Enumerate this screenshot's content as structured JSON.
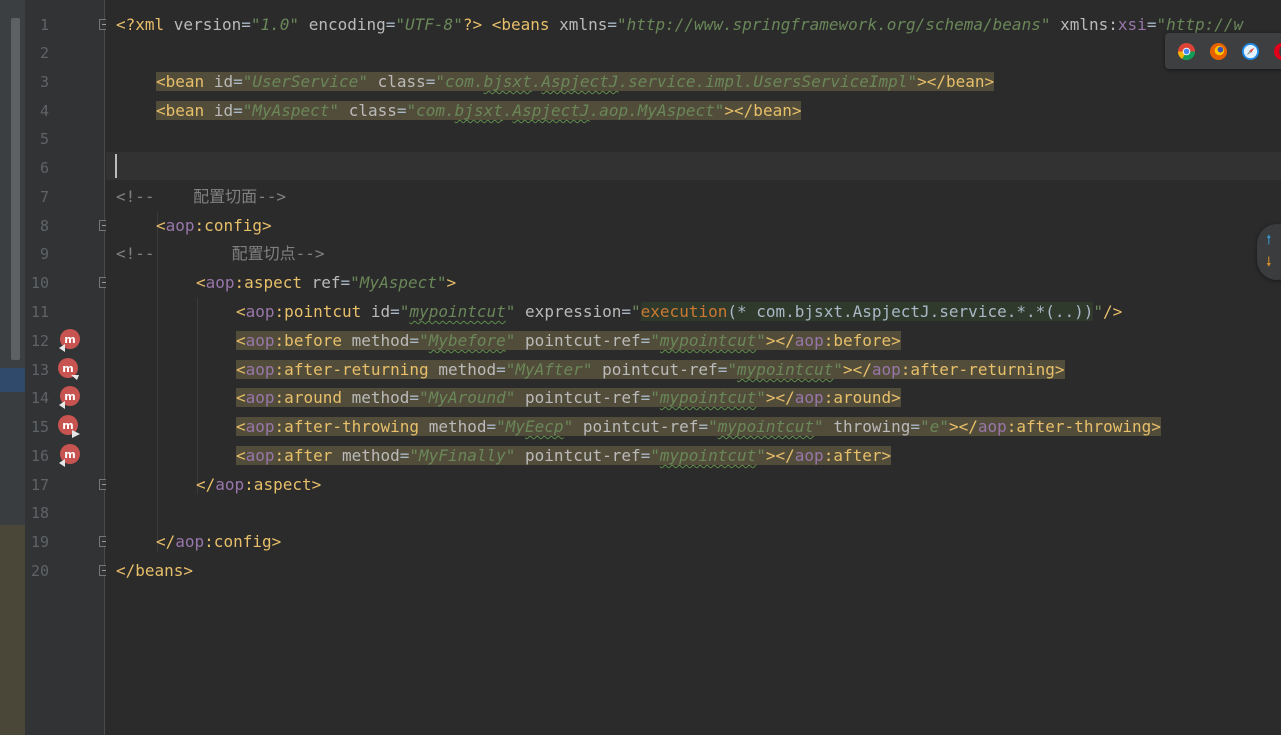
{
  "editor": {
    "line_numbers": [
      "1",
      "2",
      "3",
      "4",
      "5",
      "6",
      "7",
      "8",
      "9",
      "10",
      "11",
      "12",
      "13",
      "14",
      "15",
      "16",
      "17",
      "18",
      "19",
      "20"
    ],
    "lines": {
      "l1": {
        "open_pi": "<?xml ",
        "version_attr": "version",
        "eq1": "=",
        "version_val": "\"1.0\"",
        "sp1": " ",
        "encoding_attr": "encoding",
        "eq2": "=",
        "encoding_val": "\"UTF-8\"",
        "close_pi": "?>",
        "sp2": " ",
        "open_tag": "<beans",
        "sp3": " ",
        "xmlns_attr": "xmlns",
        "eq3": "=",
        "xmlns_val": "\"http://www.springframework.org/schema/beans\"",
        "sp4": " ",
        "xmlns_prefix": "xmlns:",
        "xsi_ns": "xsi",
        "eq4": "=",
        "xsi_val": "\"http://w"
      },
      "l3": {
        "open": "<bean",
        "sp1": " ",
        "id_attr": "id",
        "eq1": "=",
        "id_val": "\"UserService\"",
        "sp2": " ",
        "class_attr": "class",
        "eq2": "=",
        "class_val_1": "\"com.",
        "class_val_2": "bjsxt",
        "class_val_3": ".",
        "class_val_4": "AspjectJ",
        "class_val_5": ".service.impl.UsersServiceImpl\"",
        "close": "></bean>"
      },
      "l4": {
        "open": "<bean",
        "sp1": " ",
        "id_attr": "id",
        "eq1": "=",
        "id_val": "\"MyAspect\"",
        "sp2": " ",
        "class_attr": "class",
        "eq2": "=",
        "class_val_1": "\"com.",
        "class_val_2": "bjsxt",
        "class_val_3": ".",
        "class_val_4": "AspjectJ",
        "class_val_5": ".aop.MyAspect\"",
        "close": "></bean>"
      },
      "l7": {
        "comment": "<!--    配置切面-->"
      },
      "l8": {
        "open": "<",
        "ns": "aop",
        "rest": ":config",
        "close": ">"
      },
      "l9": {
        "comment": "<!--        配置切点-->"
      },
      "l10": {
        "open": "<",
        "ns": "aop",
        "rest": ":aspect",
        "sp": " ",
        "attr": "ref",
        "eq": "=",
        "val": "\"MyAspect\"",
        "close": ">"
      },
      "l11": {
        "open": "<",
        "ns": "aop",
        "rest": ":pointcut",
        "sp1": " ",
        "id_attr": "id",
        "eq1": "=",
        "q1": "\"",
        "id_val": "mypointcut",
        "q2": "\"",
        "sp2": " ",
        "expr_attr": "expression",
        "eq2": "=",
        "q3": "\"",
        "fn": "execution",
        "expr_body": "(* com.bjsxt.AspjectJ.service.*.*(..))",
        "q4": "\"",
        "close": "/>"
      },
      "l12": {
        "open": "<",
        "ns": "aop",
        "rest": ":before",
        "sp1": " ",
        "method_attr": "method",
        "eq1": "=",
        "q1": "\"",
        "method_val": "Mybefore",
        "q2": "\"",
        "sp2": " ",
        "ref_attr": "pointcut-ref",
        "eq2": "=",
        "q3": "\"",
        "ref_val": "mypointcut",
        "q4": "\"",
        "mid": "></",
        "end_ns": "aop",
        "end_rest": ":before",
        "close": ">"
      },
      "l13": {
        "open": "<",
        "ns": "aop",
        "rest": ":after-returning",
        "sp1": " ",
        "method_attr": "method",
        "eq1": "=",
        "method_val_full": "\"MyAfter\"",
        "sp2": " ",
        "ref_attr": "pointcut-ref",
        "eq2": "=",
        "q3": "\"",
        "ref_val": "mypointcut",
        "q4": "\"",
        "mid": "></",
        "end_ns": "aop",
        "end_rest": ":after-returning",
        "close": ">"
      },
      "l14": {
        "open": "<",
        "ns": "aop",
        "rest": ":around",
        "sp1": " ",
        "method_attr": "method",
        "eq1": "=",
        "method_val_full": "\"MyAround\"",
        "sp2": " ",
        "ref_attr": "pointcut-ref",
        "eq2": "=",
        "q3": "\"",
        "ref_val": "mypointcut",
        "q4": "\"",
        "mid": "></",
        "end_ns": "aop",
        "end_rest": ":around",
        "close": ">"
      },
      "l15": {
        "open": "<",
        "ns": "aop",
        "rest": ":after-throwing",
        "sp1": " ",
        "method_attr": "method",
        "eq1": "=",
        "q1": "\"",
        "method_val_1": "My",
        "method_val_2": "Eecp",
        "q2": "\"",
        "sp2": " ",
        "ref_attr": "pointcut-ref",
        "eq2": "=",
        "q3": "\"",
        "ref_val": "mypointcut",
        "q4": "\"",
        "sp3": " ",
        "throw_attr": "throwing",
        "eq3": "=",
        "throw_val": "\"e\"",
        "mid": "></",
        "end_ns": "aop",
        "end_rest": ":after-throwing",
        "close": ">"
      },
      "l16": {
        "open": "<",
        "ns": "aop",
        "rest": ":after",
        "sp1": " ",
        "method_attr": "method",
        "eq1": "=",
        "method_val_full": "\"MyFinally\"",
        "sp2": " ",
        "ref_attr": "pointcut-ref",
        "eq2": "=",
        "q3": "\"",
        "ref_val": "mypointcut",
        "q4": "\"",
        "mid": "></",
        "end_ns": "aop",
        "end_rest": ":after",
        "close": ">"
      },
      "l17": {
        "open": "</",
        "ns": "aop",
        "rest": ":aspect",
        "close": ">"
      },
      "l19": {
        "open": "</",
        "ns": "aop",
        "rest": ":config",
        "close": ">"
      },
      "l20": {
        "text": "</beans>"
      }
    }
  },
  "gutter_icons": {
    "advice_icon": "method-advice-icon",
    "fold_icon": "fold-marker-icon"
  },
  "browser_icons": [
    "chrome-icon",
    "firefox-icon",
    "safari-icon",
    "opera-icon"
  ],
  "colors": {
    "background": "#2b2b2b",
    "gutter": "#313335",
    "tag": "#e8bf6a",
    "namespace": "#9876aa",
    "attribute": "#bababa",
    "value": "#6a8759",
    "comment": "#808080",
    "highlight": "#524d3a"
  }
}
